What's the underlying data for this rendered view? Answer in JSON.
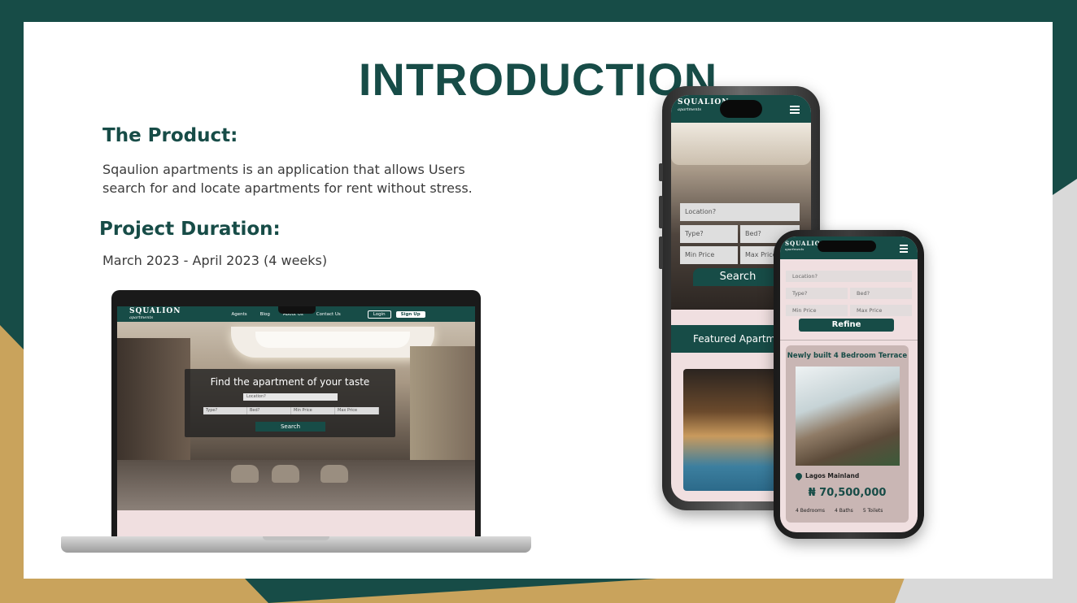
{
  "slide": {
    "title": "INTRODUCTION",
    "product_heading": "The Product:",
    "product_text_line1": "Sqaulion apartments is an application that allows Users",
    "product_text_line2": "search for and locate apartments for rent without stress.",
    "duration_heading": "Project Duration:",
    "duration_text": "March 2023 - April 2023 (4 weeks)"
  },
  "colors": {
    "brand": "#174c47",
    "gold": "#c9a35c",
    "pink": "#f0dfe0",
    "white": "#ffffff"
  },
  "laptop": {
    "logo": "SQUALION",
    "logo_sub": "apartments",
    "nav_links": [
      "Agents",
      "Blog",
      "About Us",
      "Contact Us"
    ],
    "login": "Login",
    "signup": "Sign Up",
    "hero_title": "Find the apartment of your taste",
    "location_placeholder": "Location?",
    "filters": [
      "Type?",
      "Bed?",
      "Min Price",
      "Max Price"
    ],
    "search_button": "Search"
  },
  "phone_back": {
    "logo": "SQUALION",
    "logo_sub": "apartments",
    "location_placeholder": "Location?",
    "type_placeholder": "Type?",
    "bed_placeholder": "Bed?",
    "min_price_placeholder": "Min Price",
    "max_price_placeholder": "Max Price",
    "search_button": "Search",
    "featured_heading": "Featured Apartments"
  },
  "phone_front": {
    "logo": "SQUALION",
    "logo_sub": "apartments",
    "location_placeholder": "Location?",
    "type_placeholder": "Type?",
    "bed_placeholder": "Bed?",
    "min_price_placeholder": "Min Price",
    "max_price_placeholder": "Max Price",
    "refine_button": "Refine",
    "card": {
      "title": "Newly built 4 Bedroom Terrace",
      "location": "Lagos Mainland",
      "price": "₦ 70,500,000",
      "bedrooms": "4 Bedrooms",
      "baths": "4 Baths",
      "toilets": "5 Toilets"
    }
  }
}
